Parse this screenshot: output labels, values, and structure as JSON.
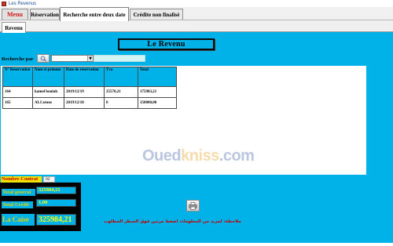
{
  "window": {
    "title": "Les Revenus"
  },
  "menu_tabs": [
    {
      "label": "Menu"
    },
    {
      "label": "Réservation"
    },
    {
      "label": "Recherche entre deux date"
    },
    {
      "label": "Crédite non finalisé"
    }
  ],
  "sub_tab": {
    "label": "Revenu"
  },
  "page_title": "Le Revenu",
  "search": {
    "label": "Recherche par",
    "selected": "",
    "value": ""
  },
  "table": {
    "headers": [
      "N° Réservation",
      "Nom et prénom",
      "Date de réservation",
      "Tva",
      "Total"
    ],
    "rows": [
      [
        "164",
        "kamel boulah",
        "2019/12/19",
        "25570,21",
        "175983,21"
      ],
      [
        "165",
        "ALI arous",
        "2019/12/18",
        "0",
        "150000,00"
      ]
    ]
  },
  "watermark": {
    "part1": "Oued",
    "part2": "kniss",
    "part3": ".com"
  },
  "nombre_contrat": {
    "label": "Nombre Contrat",
    "value": "02"
  },
  "totals": {
    "total_general_label": "Total général",
    "total_general_value": "325984,21",
    "total_credit_label": "Total Crédit",
    "total_credit_value": "1,00",
    "caisse_label": "La Caise",
    "caisse_value": "325984,21"
  },
  "note": "ملاحظة: لمزيد من المعلومات اضغط مرتين فوق السطر المطلوب",
  "colors": {
    "panel": "#00b2e8",
    "accent_red": "#d01717",
    "label_yellow": "#e7d200",
    "value_yellow": "#ffff00"
  },
  "icons": {
    "app": "app-icon",
    "search": "magnifier-icon",
    "print": "printer-icon"
  }
}
